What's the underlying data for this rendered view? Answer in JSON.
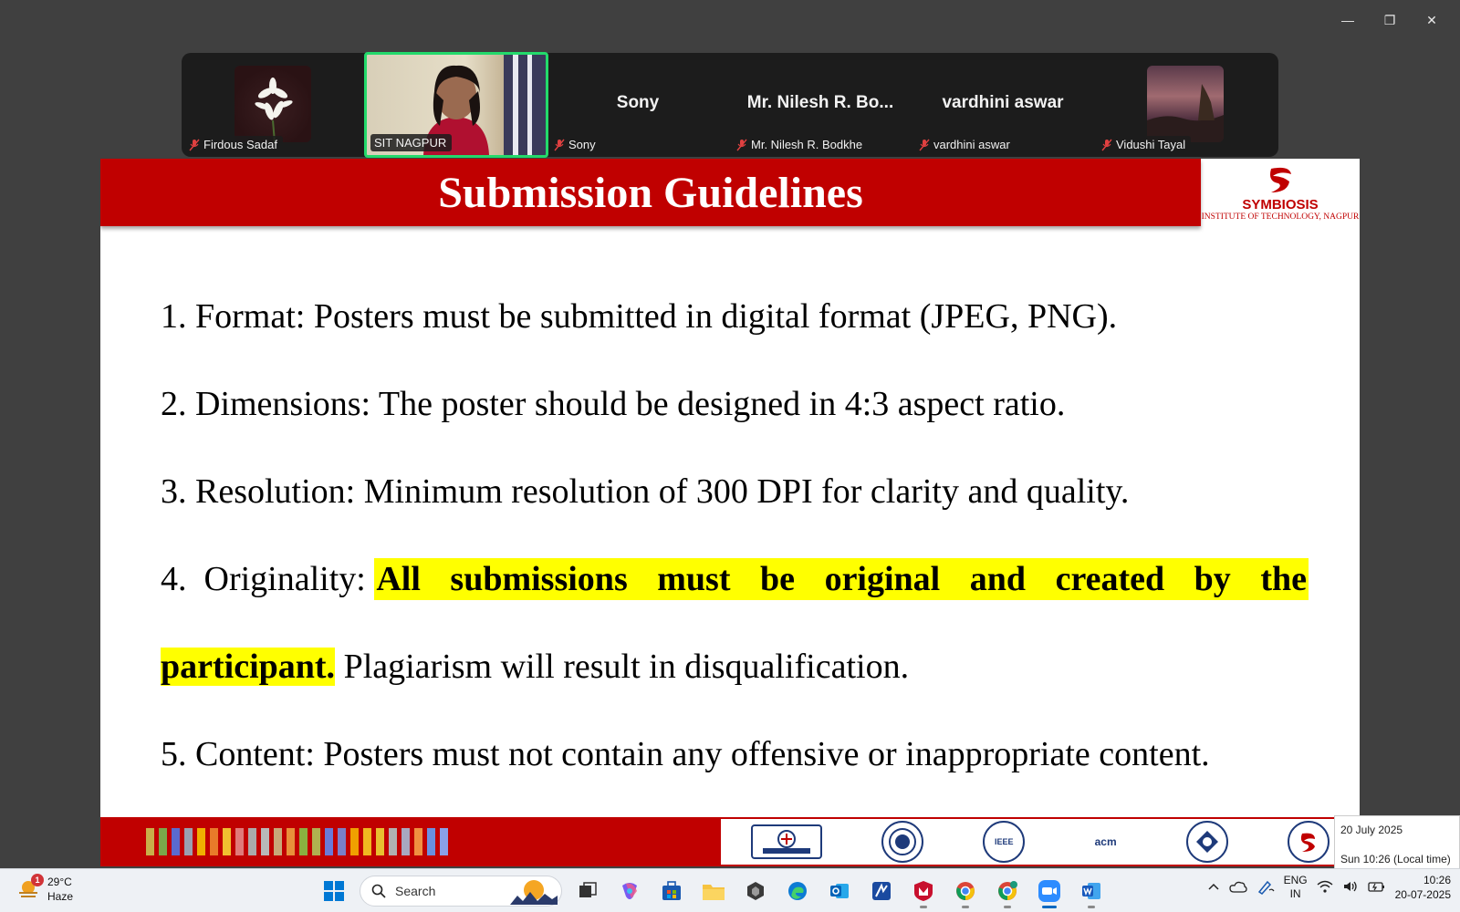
{
  "window": {
    "minimize_glyph": "—",
    "restore_glyph": "❐",
    "close_glyph": "✕"
  },
  "participants": [
    {
      "name": "Firdous Sadaf",
      "type": "avatar",
      "avatar": "flower"
    },
    {
      "name": "SIT NAGPUR",
      "type": "video",
      "active_speaker": true
    },
    {
      "name": "Sony",
      "display": "Sony",
      "type": "name"
    },
    {
      "name": "Mr. Nilesh R. Bodkhe",
      "display": "Mr. Nilesh R. Bo...",
      "type": "name"
    },
    {
      "name": "vardhini aswar",
      "display": "vardhini aswar",
      "type": "name"
    },
    {
      "name": "Vidushi Tayal",
      "type": "avatar",
      "avatar": "sunset"
    }
  ],
  "slide": {
    "title": "Submission Guidelines",
    "logo_name": "SYMBIOSIS",
    "logo_sub": "INSTITUTE OF TECHNOLOGY, NAGPUR",
    "items": {
      "i1": "1. Format: Posters must be submitted in digital format (JPEG, PNG).",
      "i2": "2. Dimensions: The poster should be designed in  4:3 aspect ratio.",
      "i3": "3. Resolution: Minimum resolution of 300 DPI for clarity and quality.",
      "i4_prefix": "4.  Originality: ",
      "i4_highlight": "All submissions must be original and created by the",
      "i4b_highlight": "participant.",
      "i4b_rest": " Plagiarism will result in disqualification.",
      "i5": "5. Content: Posters must not contain any offensive or inappropriate content."
    },
    "accent_color": "#c00000",
    "highlight_color": "#ffff00",
    "partner_logos": {
      "ieee": "IEEE",
      "acm": "acm"
    }
  },
  "date_tooltip": {
    "date": "20 July 2025",
    "local_time": "Sun 10:26 (Local time)"
  },
  "taskbar": {
    "weather_temp": "29°C",
    "weather_cond": "Haze",
    "weather_badge": "1",
    "search_placeholder": "Search",
    "lang_top": "ENG",
    "lang_bottom": "IN",
    "time": "10:26",
    "date": "20-07-2025"
  }
}
